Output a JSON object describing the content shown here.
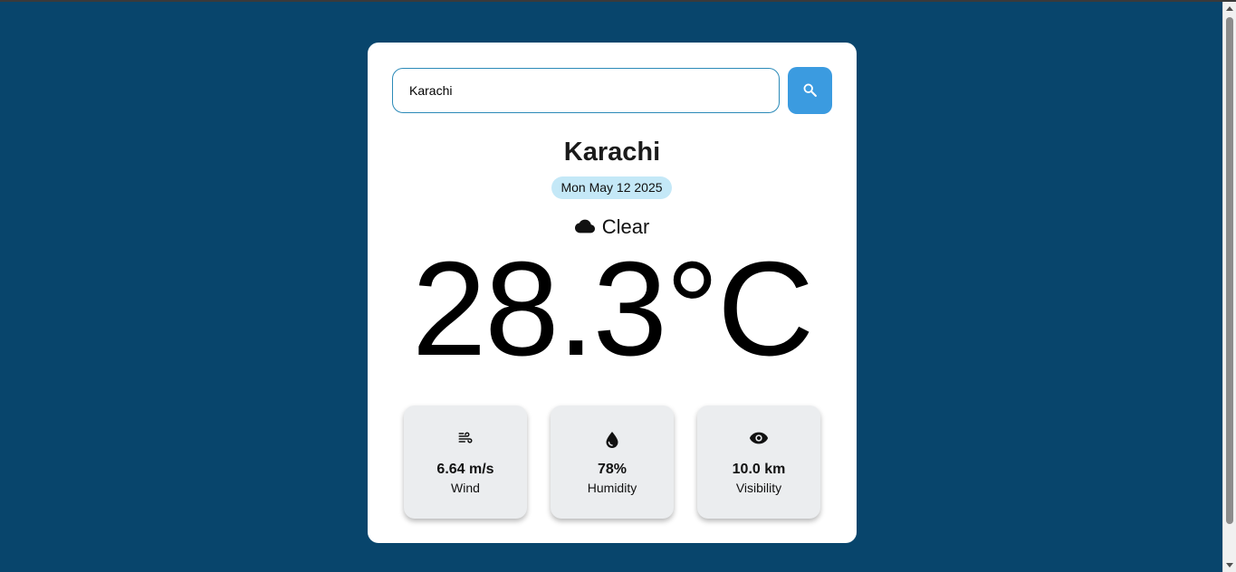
{
  "search": {
    "value": "Karachi",
    "button_icon": "search-icon"
  },
  "weather": {
    "city": "Karachi",
    "date": "Mon May 12 2025",
    "condition_icon": "cloud-icon",
    "condition": "Clear",
    "temperature": "28.3°C"
  },
  "stats": [
    {
      "icon": "wind-icon",
      "value": "6.64 m/s",
      "label": "Wind"
    },
    {
      "icon": "water-drop-icon",
      "value": "78%",
      "label": "Humidity"
    },
    {
      "icon": "eye-icon",
      "value": "10.0 km",
      "label": "Visibility"
    }
  ],
  "colors": {
    "background": "#08456c",
    "card": "#ffffff",
    "accent": "#3b9be0",
    "date_badge": "#c4e8f7",
    "stat_card": "#ebedef"
  }
}
